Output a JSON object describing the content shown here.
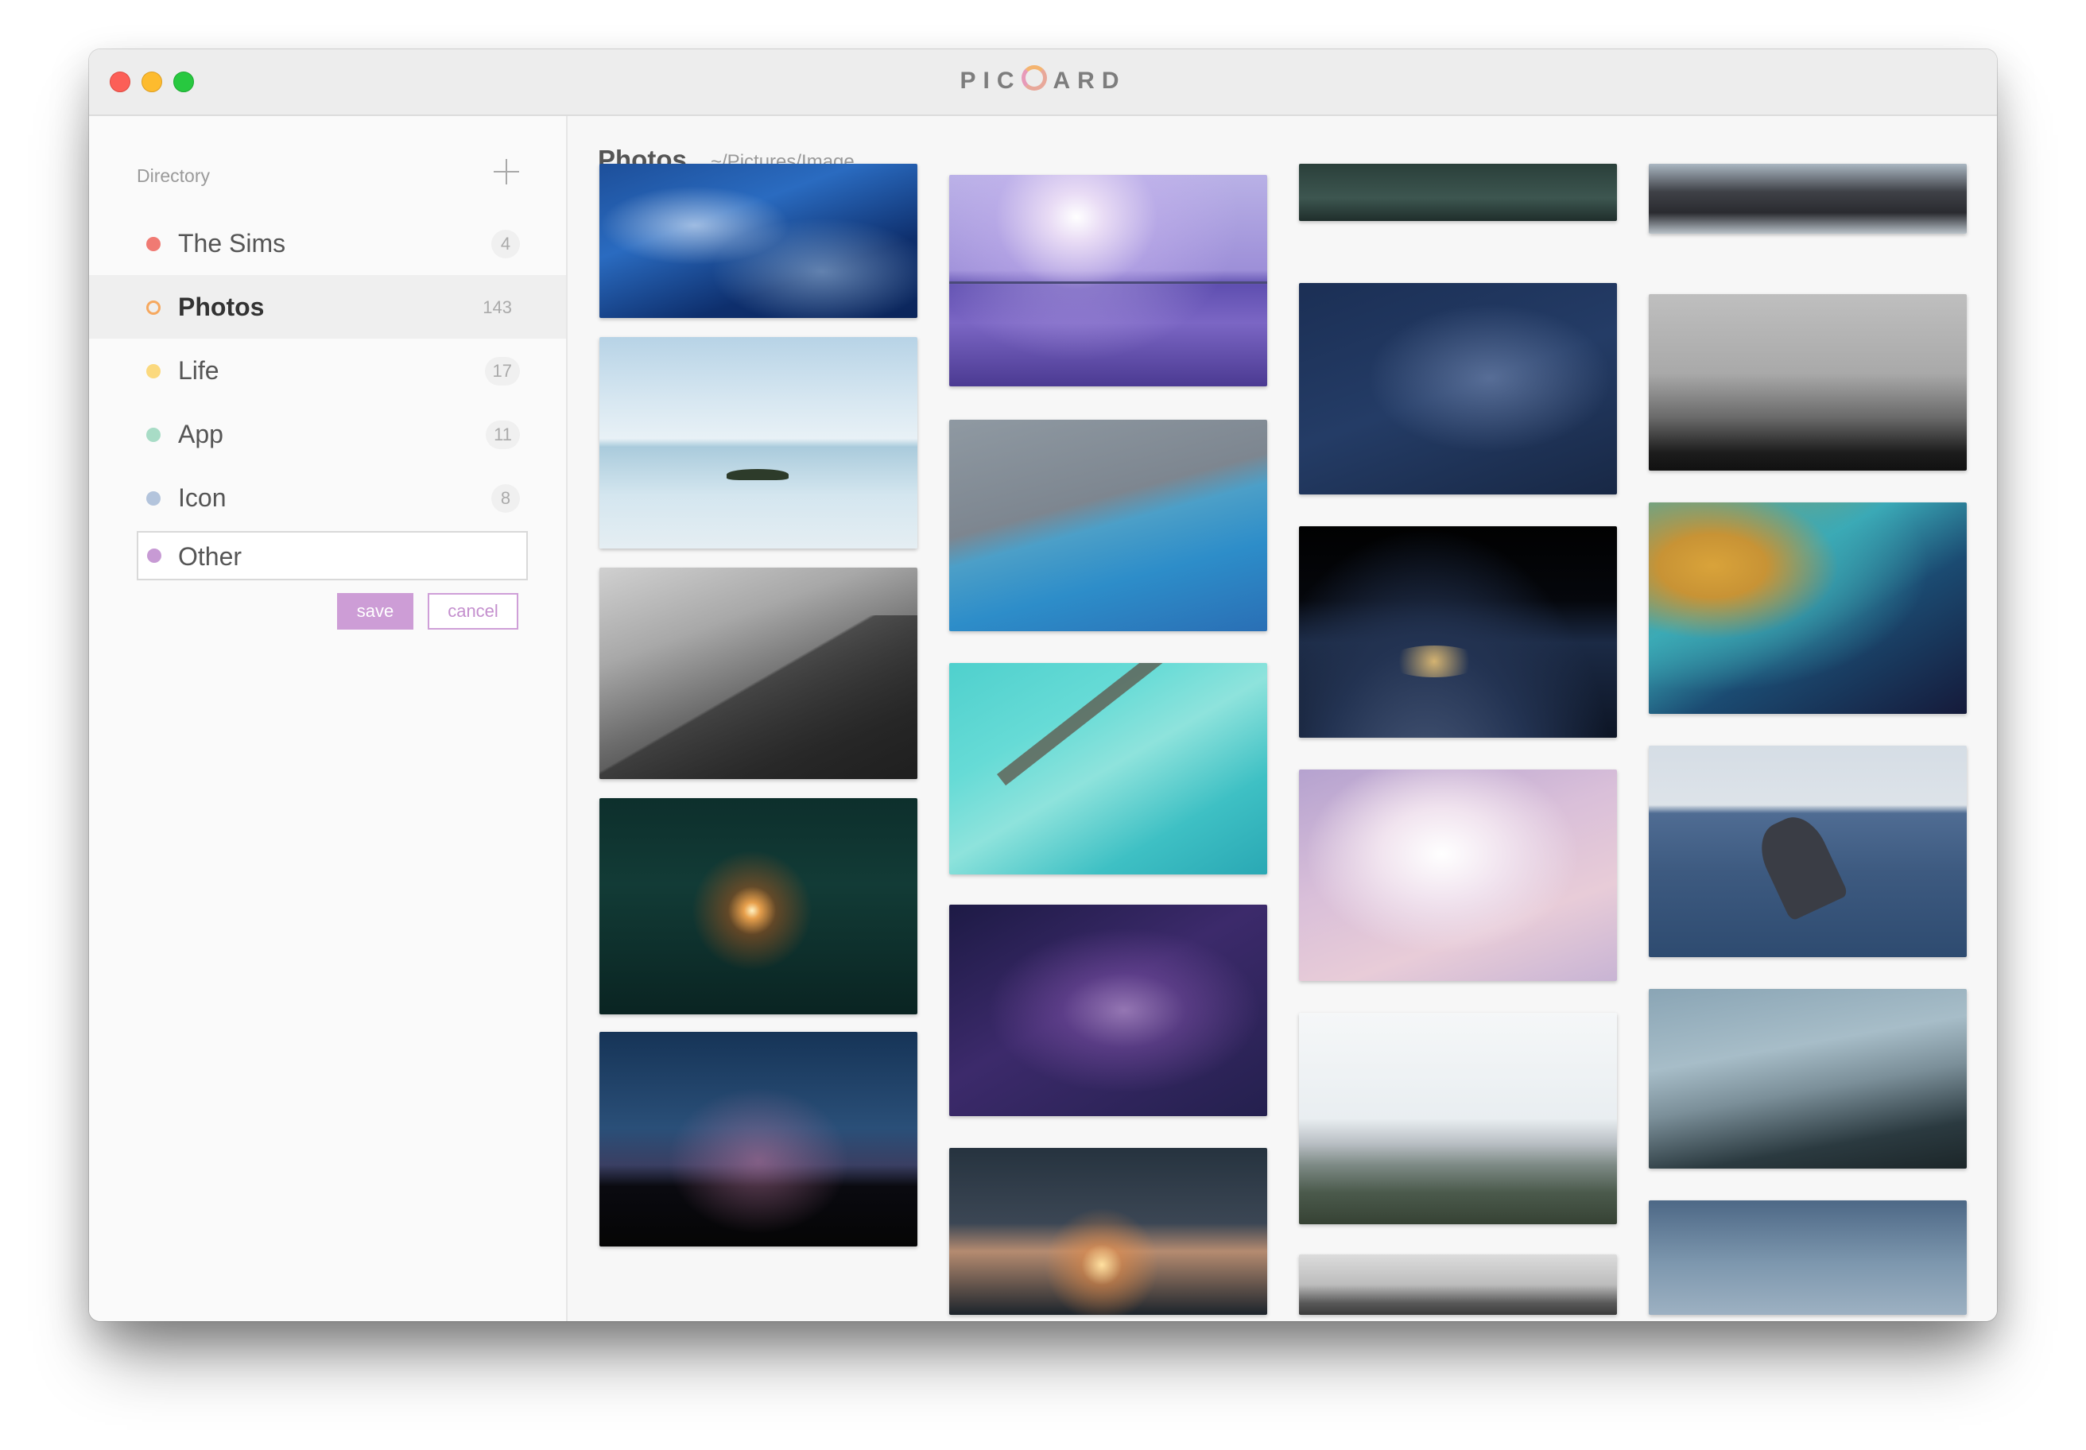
{
  "window": {
    "title_prefix": "PIC",
    "title_suffix": "ARD"
  },
  "sidebar": {
    "header": "Directory",
    "items": [
      {
        "label": "The Sims",
        "count": "4",
        "color": "#f07a73"
      },
      {
        "label": "Photos",
        "count": "143",
        "color": "#f6a85f",
        "selected": true
      },
      {
        "label": "Life",
        "count": "17",
        "color": "#fbd97e"
      },
      {
        "label": "App",
        "count": "11",
        "color": "#a8dcc6"
      },
      {
        "label": "Icon",
        "count": "8",
        "color": "#b3c4dc"
      }
    ],
    "new_directory": {
      "value": "Other",
      "color": "#c79ad4"
    },
    "save_label": "save",
    "cancel_label": "cancel"
  },
  "main": {
    "title": "Photos",
    "path": "~/Pictures/Image",
    "zoom_level": 0,
    "accent_color": "#cd9dd6"
  },
  "photos": [
    {
      "subject": "ocean waves"
    },
    {
      "subject": "purple sunset over sea bridge"
    },
    {
      "subject": "sea waves from above"
    },
    {
      "subject": "rocky shoreline"
    },
    {
      "subject": "island on calm sea"
    },
    {
      "subject": "aerial coastline"
    },
    {
      "subject": "milky way night sky"
    },
    {
      "subject": "foggy forest"
    },
    {
      "subject": "misty mountain peak"
    },
    {
      "subject": "turquoise reef aerial"
    },
    {
      "subject": "earth at night from space"
    },
    {
      "subject": "satellite view of coast"
    },
    {
      "subject": "sparkler in hands"
    },
    {
      "subject": "purple galaxy"
    },
    {
      "subject": "pink clouds"
    },
    {
      "subject": "whale breaching"
    },
    {
      "subject": "starry sky over mountains"
    },
    {
      "subject": "sparklers at dusk"
    },
    {
      "subject": "snowy mountains"
    },
    {
      "subject": "misty pine forest"
    },
    {
      "subject": "white ceiling"
    },
    {
      "subject": "misty blue sky"
    }
  ]
}
